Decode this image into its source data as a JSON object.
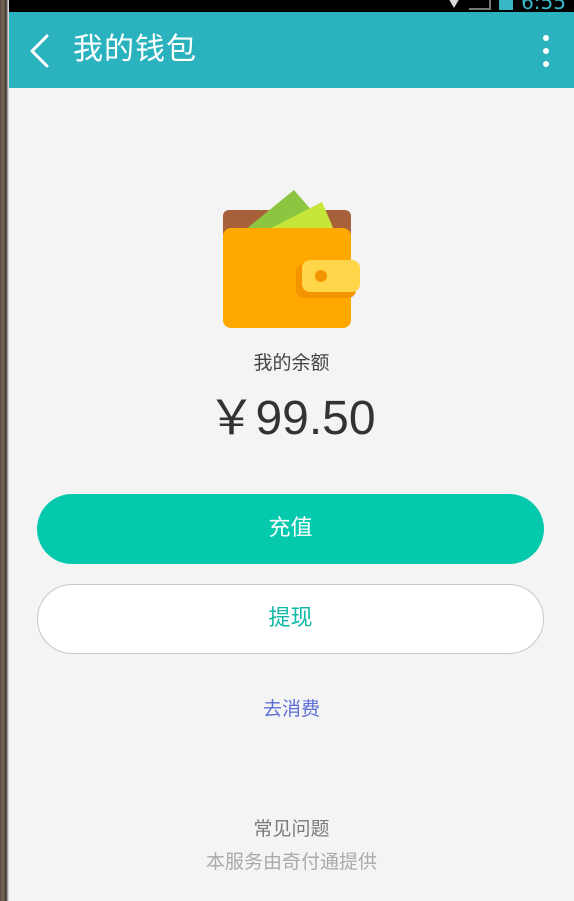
{
  "status_bar": {
    "time": "6:55"
  },
  "app_bar": {
    "title": "我的钱包",
    "back_icon": "chevron-left-icon",
    "menu_icon": "more-vertical-icon",
    "background_color": "#2ab3bf"
  },
  "wallet": {
    "icon": "wallet-icon",
    "balance_label": "我的余额",
    "balance_amount": "￥99.50"
  },
  "actions": {
    "recharge_label": "充值",
    "recharge_color": "#04c9ad",
    "withdraw_label": "提现",
    "spend_label": "去消费"
  },
  "footer": {
    "faq_label": "常见问题",
    "provider_text": "本服务由奇付通提供"
  }
}
